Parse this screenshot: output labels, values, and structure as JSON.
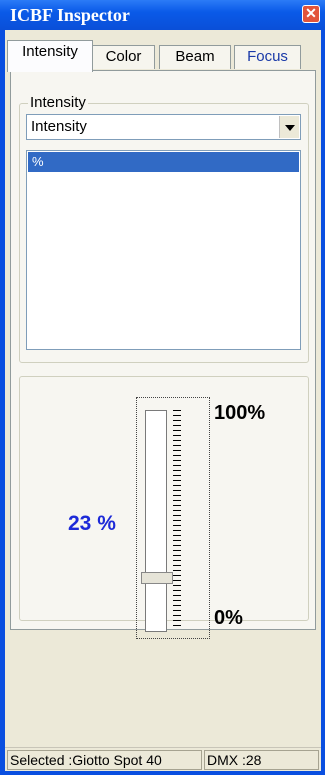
{
  "window": {
    "title": "ICBF Inspector",
    "close_glyph": "✕"
  },
  "tabs": [
    {
      "label": "Intensity",
      "active": true
    },
    {
      "label": "Color"
    },
    {
      "label": "Beam"
    },
    {
      "label": "Focus"
    }
  ],
  "intensity_group": {
    "legend": "Intensity",
    "combo_value": "Intensity",
    "list_items": [
      "%"
    ]
  },
  "fader": {
    "value_text": "23 %",
    "value": 23,
    "max_label": "100%",
    "min_label": "0%"
  },
  "status": {
    "selected": "Selected :Giotto Spot 40",
    "dmx": "DMX :28"
  },
  "colors": {
    "value_text": "#1d2ad8",
    "title_bar": "#0a4fe0",
    "selection": "#316ac5"
  }
}
